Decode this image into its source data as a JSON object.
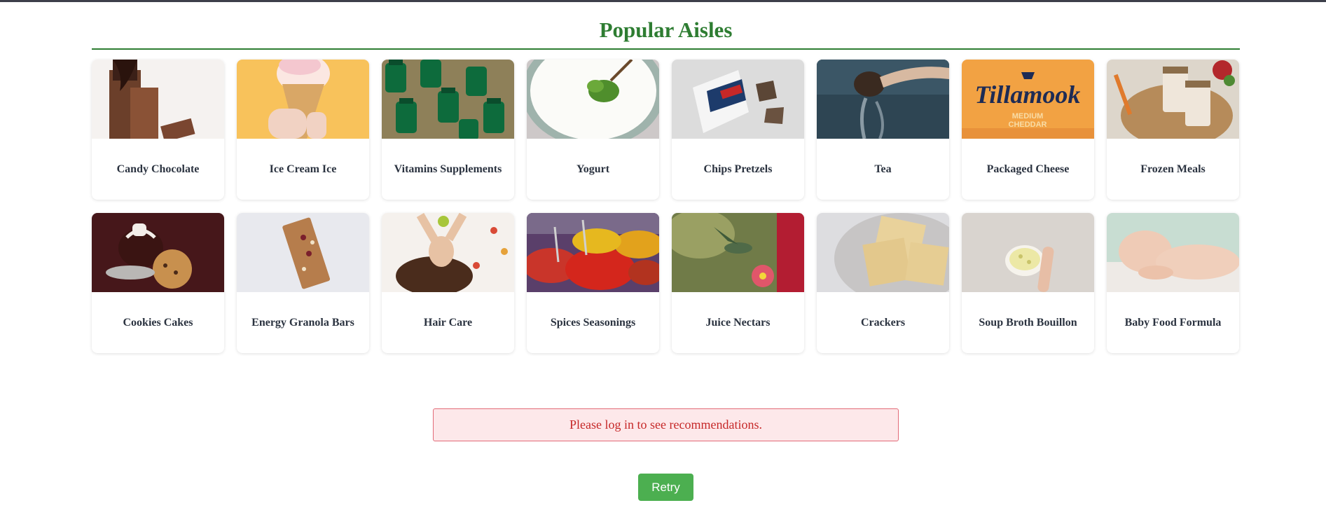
{
  "section": {
    "title": "Popular Aisles"
  },
  "aisles": [
    {
      "label": "Candy Chocolate",
      "icon": "chocolate-image",
      "bg": "#f4f0ee"
    },
    {
      "label": "Ice Cream Ice",
      "icon": "ice-cream-cone-image",
      "bg": "#f7c15a"
    },
    {
      "label": "Vitamins Supplements",
      "icon": "vitamin-bottles-image",
      "bg": "#8c7d55"
    },
    {
      "label": "Yogurt",
      "icon": "yogurt-bowl-image",
      "bg": "#c9cfc9"
    },
    {
      "label": "Chips Pretzels",
      "icon": "chips-bag-image",
      "bg": "#dcdcdc"
    },
    {
      "label": "Tea",
      "icon": "tea-pour-image",
      "bg": "#2f4655"
    },
    {
      "label": "Packaged Cheese",
      "icon": "cheese-package-image",
      "bg": "#f2a243"
    },
    {
      "label": "Frozen Meals",
      "icon": "meal-jars-image",
      "bg": "#d9d2c6"
    },
    {
      "label": "Cookies Cakes",
      "icon": "cookies-cake-image",
      "bg": "#4a1a1c"
    },
    {
      "label": "Energy Granola Bars",
      "icon": "granola-bar-image",
      "bg": "#e6e7ec"
    },
    {
      "label": "Hair Care",
      "icon": "hair-care-image",
      "bg": "#f4f0ec"
    },
    {
      "label": "Spices Seasonings",
      "icon": "spices-image",
      "bg": "#b23a2a"
    },
    {
      "label": "Juice Nectars",
      "icon": "hummingbird-image",
      "bg": "#6f7a45"
    },
    {
      "label": "Crackers",
      "icon": "crackers-image",
      "bg": "#dcdcde"
    },
    {
      "label": "Soup Broth Bouillon",
      "icon": "soup-bowl-image",
      "bg": "#d8d4cf"
    },
    {
      "label": "Baby Food Formula",
      "icon": "baby-image",
      "bg": "#c7ddd3"
    }
  ],
  "error": {
    "message": "Please log in to see recommendations."
  },
  "retry": {
    "label": "Retry"
  },
  "colors": {
    "accent_green": "#2e7d32",
    "button_green": "#4caf50",
    "error_red": "#c62828",
    "error_bg": "#fde8ea"
  }
}
